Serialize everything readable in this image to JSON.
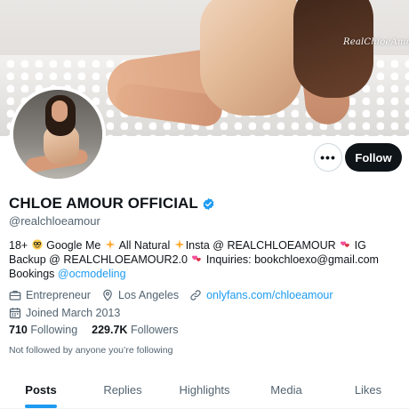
{
  "banner": {
    "watermark": "RealChloeAmour"
  },
  "profile": {
    "display_name": "CHLOE AMOUR OFFICIAL",
    "handle": "@realchloeamour",
    "verified": true
  },
  "actions": {
    "more_label": "•••",
    "follow_label": "Follow"
  },
  "bio": {
    "seg1": "18+ ",
    "seg2": " Google Me ",
    "seg3": " All Natural ",
    "seg4": "Insta @ REALCHLOEAMOUR ",
    "seg5": " IG Backup @ REALCHLOEAMOUR2.0 ",
    "seg6": " Inquiries: bookchloexo@gmail.com Bookings ",
    "mention": "@ocmodeling"
  },
  "meta": {
    "profession": "Entrepreneur",
    "location": "Los Angeles",
    "website": "onlyfans.com/chloeamour",
    "joined": "Joined March 2013"
  },
  "stats": {
    "following_count": "710",
    "following_label": "Following",
    "followers_count": "229.7K",
    "followers_label": "Followers"
  },
  "followed_by_note": "Not followed by anyone you’re following",
  "tabs": [
    {
      "label": "Posts",
      "active": true
    },
    {
      "label": "Replies",
      "active": false
    },
    {
      "label": "Highlights",
      "active": false
    },
    {
      "label": "Media",
      "active": false
    },
    {
      "label": "Likes",
      "active": false
    }
  ],
  "colors": {
    "accent": "#1d9bf0",
    "text": "#0f1419",
    "muted": "#536471",
    "follow_bg": "#0f1419"
  }
}
